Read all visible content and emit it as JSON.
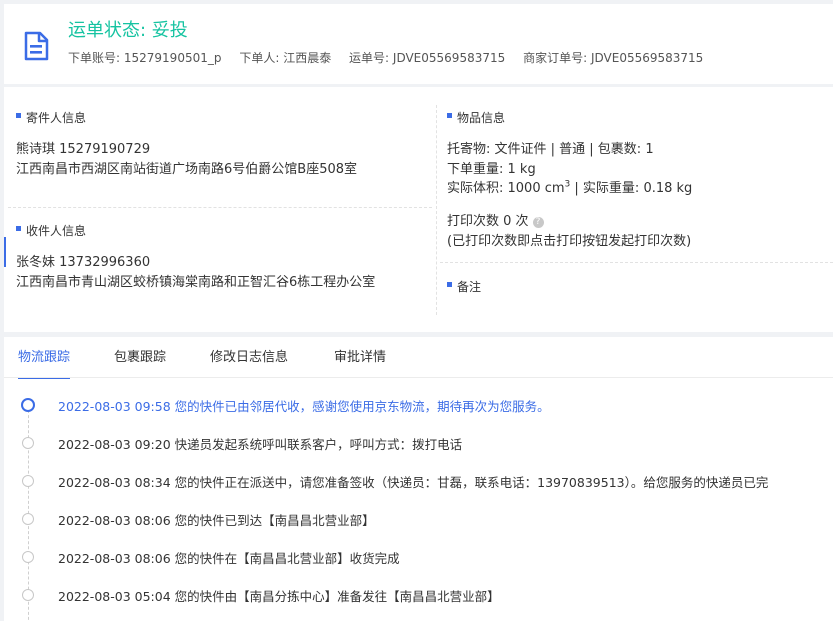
{
  "header": {
    "status": "运单状态: 妥投",
    "meta": [
      {
        "label": "下单账号:",
        "value": "15279190501_p"
      },
      {
        "label": "下单人:",
        "value": "江西晨泰"
      },
      {
        "label": "运单号:",
        "value": "JDVE05569583715"
      },
      {
        "label": "商家订单号:",
        "value": "JDVE05569583715"
      }
    ],
    "icon": "document-icon",
    "accent": "#15c3a1"
  },
  "sender": {
    "title": "寄件人信息",
    "name_phone": "熊诗琪   15279190729",
    "address": "江西南昌市西湖区南站街道广场南路6号伯爵公馆B座508室"
  },
  "receiver": {
    "title": "收件人信息",
    "name_phone": "张冬妹   13732996360",
    "address": "江西南昌市青山湖区蛟桥镇海棠南路和正智汇谷6栋工程办公室"
  },
  "goods": {
    "title": "物品信息",
    "line1": "托寄物:  文件证件 | 普通  |  包裹数:  1",
    "line2": "下单重量:   1 kg",
    "volume_label": "实际体积:   1000 cm",
    "volume_sup": "3",
    "weight_actual": " |  实际重量:   0.18 kg",
    "print_count": "打印次数   0 次",
    "print_hint": "(已打印次数即点击打印按钮发起打印次数)"
  },
  "remark": {
    "title": "备注"
  },
  "tabs": [
    "物流跟踪",
    "包裹跟踪",
    "修改日志信息",
    "审批详情"
  ],
  "timeline": [
    "2022-08-03 09:58 您的快件已由邻居代收，感谢您使用京东物流，期待再次为您服务。",
    "2022-08-03 09:20 快递员发起系统呼叫联系客户，呼叫方式：拨打电话",
    "2022-08-03 08:34 您的快件正在派送中，请您准备签收（快递员：甘磊，联系电话：13970839513）。给您服务的快递员已完",
    "2022-08-03 08:06 您的快件已到达【南昌昌北营业部】",
    "2022-08-03 08:06 您的快件在【南昌昌北营业部】收货完成",
    "2022-08-03 05:04 您的快件由【南昌分拣中心】准备发往【南昌昌北营业部】"
  ],
  "colors": {
    "primary": "#3b6ce6",
    "status": "#15c3a1"
  }
}
